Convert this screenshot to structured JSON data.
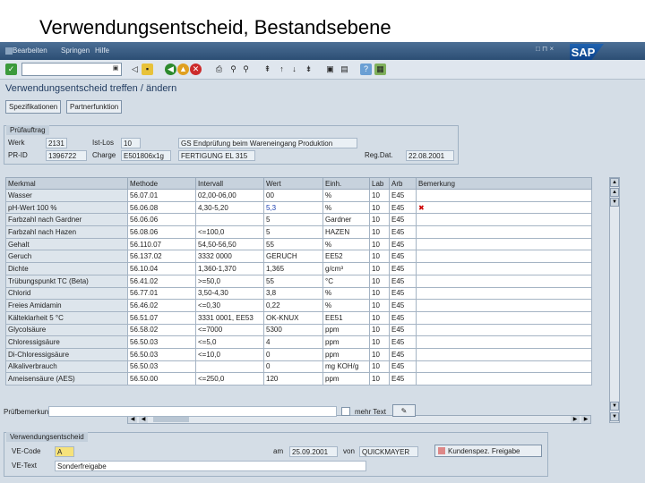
{
  "slide_title": "Verwendungsentscheid, Bestandsebene",
  "menu": [
    "Bearbeiten",
    "Springen",
    "Hilfe"
  ],
  "window_controls": "□ ⊓ ×",
  "sap_logo": "SAP",
  "app_title": "Verwendungsentscheid treffen / ändern",
  "app_buttons": [
    "Spezifikationen",
    "Partnerfunktion"
  ],
  "inspection_lot": {
    "group_label": "Prüfauftrag",
    "werk_label": "Werk",
    "werk": "2131",
    "label2": "Ist-Los",
    "value2": "10",
    "desc": "GS Endprüfung beim Wareneingang Produktion",
    "pruefid_label": "PR-ID",
    "pruefid": "1396722",
    "charge_label": "Charge",
    "charge": "E501806x1g",
    "field3": "FERTIGUNG EL 315",
    "regdat_label": "Reg.Dat.",
    "regdat": "22.08.2001"
  },
  "table": {
    "columns": [
      "Merkmal",
      "Methode",
      "Intervall",
      "Wert",
      "Einh.",
      "Lab",
      "Arb",
      "Bemerkung"
    ],
    "rows": [
      [
        "Wasser",
        "56.07.01",
        "02,00-06,00",
        "00",
        "%",
        "10",
        "E45",
        ""
      ],
      [
        "pH-Wert 100 %",
        "56.06.08",
        "4,30-5,20",
        "5,3",
        "%",
        "10",
        "E45",
        "✖"
      ],
      [
        "Farbzahl nach Gardner",
        "56.06.06",
        "",
        "5",
        "Gardner",
        "10",
        "E45",
        ""
      ],
      [
        "Farbzahl nach Hazen",
        "56.08.06",
        "<=100,0",
        "5",
        "HAZEN",
        "10",
        "E45",
        ""
      ],
      [
        "Gehalt",
        "56.110.07",
        "54,50-56,50",
        "55",
        "%",
        "10",
        "E45",
        ""
      ],
      [
        "Geruch",
        "56.137.02",
        "3332 0000",
        "GERUCH",
        "EE52",
        "10",
        "E45",
        ""
      ],
      [
        "Dichte",
        "56.10.04",
        "1,360-1,370",
        "1,365",
        "g/cm³",
        "10",
        "E45",
        ""
      ],
      [
        "Trübungspunkt TC (Beta)",
        "56.41.02",
        ">=50,0",
        "55",
        "°C",
        "10",
        "E45",
        ""
      ],
      [
        "Chlorid",
        "56.77.01",
        "3,50-4,30",
        "3,8",
        "%",
        "10",
        "E45",
        ""
      ],
      [
        "Freies Amidamin",
        "56.46.02",
        "<=0,30",
        "0,22",
        "%",
        "10",
        "E45",
        ""
      ],
      [
        "Kälteklarheit 5 °C",
        "56.51.07",
        "3331 0001, EE53",
        "OK-KNUX",
        "EE51",
        "10",
        "E45",
        ""
      ],
      [
        "Glycolsäure",
        "56.58.02",
        "<=7000",
        "5300",
        "ppm",
        "10",
        "E45",
        ""
      ],
      [
        "Chloressigsäure",
        "56.50.03",
        "<=5,0",
        "4",
        "ppm",
        "10",
        "E45",
        ""
      ],
      [
        "Di-Chloressigsäure",
        "56.50.03",
        "<=10,0",
        "0",
        "ppm",
        "10",
        "E45",
        ""
      ],
      [
        "Alkaliverbrauch",
        "56.50.03",
        "",
        "0",
        "mg KOH/g",
        "10",
        "E45",
        ""
      ],
      [
        "Ameisensäure (AES)",
        "56.50.00",
        "<=250,0",
        "120",
        "ppm",
        "10",
        "E45",
        ""
      ]
    ]
  },
  "pruefbemerkung": {
    "label": "Prüfbemerkung",
    "langtext": "mehr Text"
  },
  "ud": {
    "group_label": "Verwendungsentscheid",
    "code_label": "VE-Code",
    "code": "A",
    "date_label": "am",
    "date": "25.09.2001",
    "by_label": "von",
    "by": "QUICKMAYER",
    "text_label": "VE-Text",
    "text": "Sonderfreigabe",
    "button": "Kundenspez. Freigabe"
  },
  "colors": {
    "menubar": "#2c4e74",
    "background": "#d4dde6",
    "error": "#cc0000"
  }
}
